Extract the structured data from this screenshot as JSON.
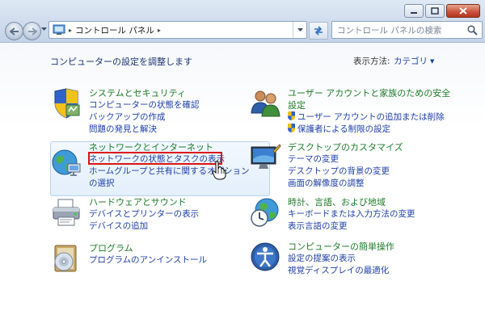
{
  "window": {
    "buttons": [
      "minimize",
      "maximize",
      "close"
    ]
  },
  "address_bar": {
    "crumb": "コントロール パネル",
    "separator": "▸",
    "separator_end": "▸"
  },
  "search": {
    "placeholder": "コントロール パネルの検索"
  },
  "main": {
    "heading": "コンピューターの設定を調整します",
    "view_label": "表示方法:",
    "view_value": "カテゴリ"
  },
  "categories": [
    {
      "title": "システムとセキュリティ",
      "icon": "shield-security-icon",
      "links": [
        "コンピューターの状態を確認",
        "バックアップの作成",
        "問題の発見と解決"
      ]
    },
    {
      "title": "ネットワークとインターネット",
      "icon": "network-globe-icon",
      "links": [
        "ネットワークの状態とタスクの表示",
        "ホームグループと共有に関するオプション",
        "の選択"
      ]
    },
    {
      "title": "ハードウェアとサウンド",
      "icon": "printer-icon",
      "links": [
        "デバイスとプリンターの表示",
        "デバイスの追加"
      ]
    },
    {
      "title": "プログラム",
      "icon": "program-disc-icon",
      "links": [
        "プログラムのアンインストール"
      ]
    },
    {
      "title": "ユーザー アカウントと家族のための安全",
      "title2": "設定",
      "icon": "users-icon",
      "links": [
        "ユーザー アカウントの追加または削除",
        "保護者による制限の設定"
      ]
    },
    {
      "title": "デスクトップのカスタマイズ",
      "icon": "desktop-icon",
      "links": [
        "テーマの変更",
        "デスクトップの背景の変更",
        "画面の解像度の調整"
      ]
    },
    {
      "title": "時計、言語、および地域",
      "icon": "clock-globe-icon",
      "links": [
        "キーボードまたは入力方法の変更",
        "表示言語の変更"
      ]
    },
    {
      "title": "コンピューターの簡単操作",
      "icon": "accessibility-icon",
      "links": [
        "設定の提案の表示",
        "視覚ディスプレイの最適化"
      ]
    }
  ],
  "colors": {
    "category_title": "#1e7b2a",
    "link": "#1e3fa8",
    "highlight_border": "#dd1414",
    "hover_bg": "#e3effc"
  }
}
